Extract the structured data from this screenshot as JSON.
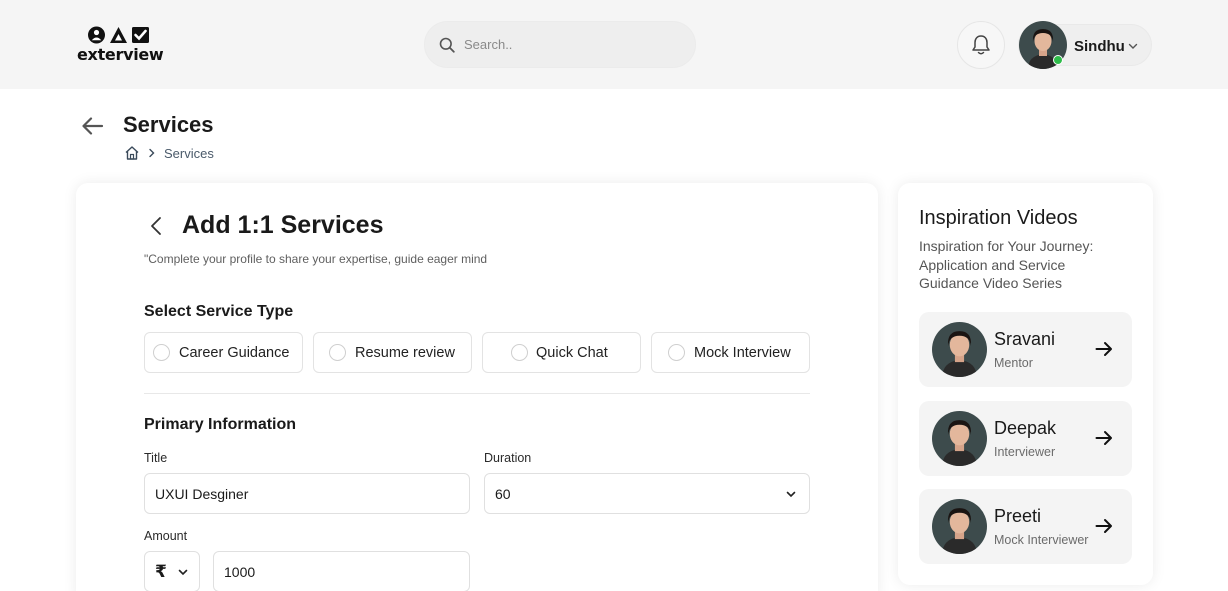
{
  "brand": {
    "name": "exterview"
  },
  "search": {
    "placeholder": "Search.."
  },
  "user": {
    "name": "Sindhu"
  },
  "page": {
    "title": "Services",
    "breadcrumb": {
      "current": "Services"
    }
  },
  "form": {
    "title": "Add 1:1 Services",
    "subtitle": "\"Complete your profile to share your expertise, guide eager mind",
    "service_type_label": "Select Service Type",
    "service_types": [
      {
        "label": "Career Guidance"
      },
      {
        "label": "Resume review"
      },
      {
        "label": "Quick Chat"
      },
      {
        "label": "Mock Interview"
      }
    ],
    "primary_label": "Primary Information",
    "title_label": "Title",
    "title_value": "UXUI Desginer",
    "duration_label": "Duration",
    "duration_value": "60",
    "amount_label": "Amount",
    "currency": "₹",
    "amount_value": "1000"
  },
  "inspiration": {
    "title": "Inspiration Videos",
    "description": "Inspiration for Your Journey: Application and Service Guidance Video Series",
    "people": [
      {
        "name": "Sravani",
        "role": "Mentor"
      },
      {
        "name": "Deepak",
        "role": "Interviewer"
      },
      {
        "name": "Preeti",
        "role": "Mock Interviewer"
      }
    ]
  }
}
